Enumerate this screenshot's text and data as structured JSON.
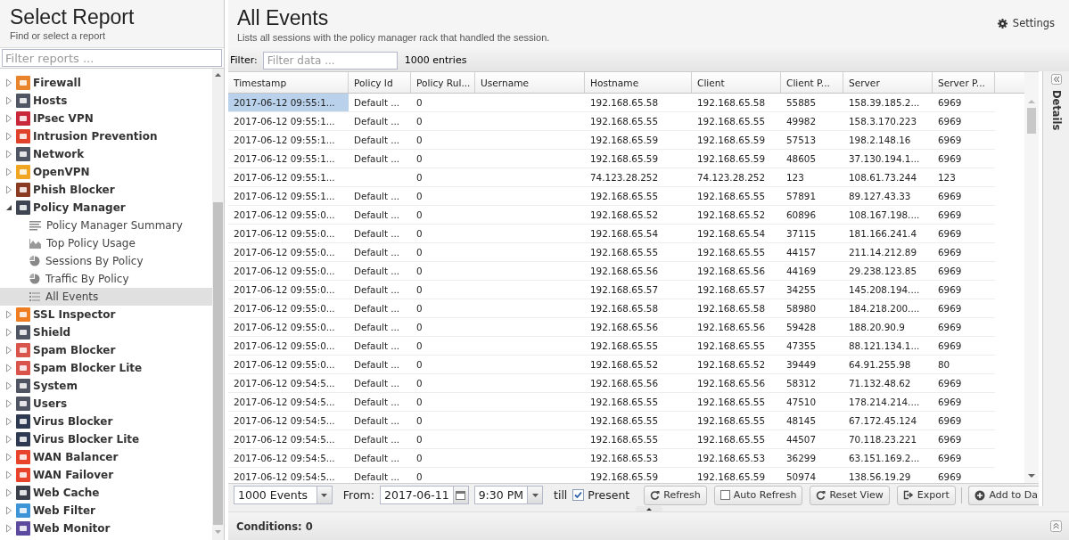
{
  "sidebar": {
    "title": "Select Report",
    "subtitle": "Find or select a report",
    "filter": {
      "placeholder": "Filter reports ..."
    },
    "items": [
      {
        "label": "Firewall",
        "color": "#e8852c",
        "expanded": false,
        "selected": false
      },
      {
        "label": "Hosts",
        "color": "#4f5563",
        "expanded": false,
        "selected": false
      },
      {
        "label": "IPsec VPN",
        "color": "#c8283a",
        "expanded": false,
        "selected": false
      },
      {
        "label": "Intrusion Prevention",
        "color": "#e0412b",
        "expanded": false,
        "selected": false
      },
      {
        "label": "Network",
        "color": "#4f5563",
        "expanded": false,
        "selected": false
      },
      {
        "label": "OpenVPN",
        "color": "#f0a623",
        "expanded": false,
        "selected": false
      },
      {
        "label": "Phish Blocker",
        "color": "#8a3b22",
        "expanded": false,
        "selected": false
      },
      {
        "label": "Policy Manager",
        "color": "#3f4452",
        "expanded": true,
        "selected": false,
        "children": [
          {
            "label": "Policy Manager Summary",
            "kind": "text",
            "selected": false
          },
          {
            "label": "Top Policy Usage",
            "kind": "area",
            "selected": false
          },
          {
            "label": "Sessions By Policy",
            "kind": "pie",
            "selected": false
          },
          {
            "label": "Traffic By Policy",
            "kind": "pie",
            "selected": false
          },
          {
            "label": "All Events",
            "kind": "list",
            "selected": true
          }
        ]
      },
      {
        "label": "SSL Inspector",
        "color": "#ef7d22",
        "expanded": false,
        "selected": false
      },
      {
        "label": "Shield",
        "color": "#4f5563",
        "expanded": false,
        "selected": false
      },
      {
        "label": "Spam Blocker",
        "color": "#d9544a",
        "expanded": false,
        "selected": false
      },
      {
        "label": "Spam Blocker Lite",
        "color": "#d9544a",
        "expanded": false,
        "selected": false
      },
      {
        "label": "System",
        "color": "#4f5563",
        "expanded": false,
        "selected": false
      },
      {
        "label": "Users",
        "color": "#4f5563",
        "expanded": false,
        "selected": false
      },
      {
        "label": "Virus Blocker",
        "color": "#2d3a52",
        "expanded": false,
        "selected": false
      },
      {
        "label": "Virus Blocker Lite",
        "color": "#2d3a52",
        "expanded": false,
        "selected": false
      },
      {
        "label": "WAN Balancer",
        "color": "#e8432b",
        "expanded": false,
        "selected": false
      },
      {
        "label": "WAN Failover",
        "color": "#e8432b",
        "expanded": false,
        "selected": false
      },
      {
        "label": "Web Cache",
        "color": "#3b3f4a",
        "expanded": false,
        "selected": false
      },
      {
        "label": "Web Filter",
        "color": "#3d95d8",
        "expanded": false,
        "selected": false
      },
      {
        "label": "Web Monitor",
        "color": "#5b4a9e",
        "expanded": false,
        "selected": false
      }
    ]
  },
  "report": {
    "title": "All Events",
    "description": "Lists all sessions with the policy manager rack that handled the session.",
    "settings": "Settings"
  },
  "filter": {
    "label": "Filter:",
    "placeholder": "Filter data ...",
    "count": "1000 entries"
  },
  "table": {
    "columns": [
      "Timestamp",
      "Policy Id",
      "Policy Rul...",
      "Username",
      "Hostname",
      "Client",
      "Client P...",
      "Server",
      "Server P..."
    ],
    "rows": [
      {
        "selected": true,
        "cells": [
          "2017-06-12 09:55:1...",
          "Default ...",
          "0",
          "",
          "192.168.65.58",
          "192.168.65.58",
          "55885",
          "158.39.185.2...",
          "6969"
        ]
      },
      {
        "selected": false,
        "cells": [
          "2017-06-12 09:55:1...",
          "Default ...",
          "0",
          "",
          "192.168.65.55",
          "192.168.65.55",
          "49982",
          "158.3.170.223",
          "6969"
        ]
      },
      {
        "selected": false,
        "cells": [
          "2017-06-12 09:55:1...",
          "Default ...",
          "0",
          "",
          "192.168.65.59",
          "192.168.65.59",
          "57513",
          "198.2.148.16",
          "6969"
        ]
      },
      {
        "selected": false,
        "cells": [
          "2017-06-12 09:55:1...",
          "Default ...",
          "0",
          "",
          "192.168.65.59",
          "192.168.65.59",
          "48605",
          "37.130.194.1...",
          "6969"
        ]
      },
      {
        "selected": false,
        "cells": [
          "2017-06-12 09:55:1...",
          "",
          "0",
          "",
          "74.123.28.252",
          "74.123.28.252",
          "123",
          "108.61.73.244",
          "123"
        ]
      },
      {
        "selected": false,
        "cells": [
          "2017-06-12 09:55:1...",
          "Default ...",
          "0",
          "",
          "192.168.65.55",
          "192.168.65.55",
          "57891",
          "89.127.43.33",
          "6969"
        ]
      },
      {
        "selected": false,
        "cells": [
          "2017-06-12 09:55:0...",
          "Default ...",
          "0",
          "",
          "192.168.65.52",
          "192.168.65.52",
          "60896",
          "108.167.198....",
          "6969"
        ]
      },
      {
        "selected": false,
        "cells": [
          "2017-06-12 09:55:0...",
          "Default ...",
          "0",
          "",
          "192.168.65.54",
          "192.168.65.54",
          "37115",
          "181.166.241.4",
          "6969"
        ]
      },
      {
        "selected": false,
        "cells": [
          "2017-06-12 09:55:0...",
          "Default ...",
          "0",
          "",
          "192.168.65.55",
          "192.168.65.55",
          "44157",
          "211.14.212.89",
          "6969"
        ]
      },
      {
        "selected": false,
        "cells": [
          "2017-06-12 09:55:0...",
          "Default ...",
          "0",
          "",
          "192.168.65.56",
          "192.168.65.56",
          "44169",
          "29.238.123.85",
          "6969"
        ]
      },
      {
        "selected": false,
        "cells": [
          "2017-06-12 09:55:0...",
          "Default ...",
          "0",
          "",
          "192.168.65.57",
          "192.168.65.57",
          "34255",
          "145.208.194....",
          "6969"
        ]
      },
      {
        "selected": false,
        "cells": [
          "2017-06-12 09:55:0...",
          "Default ...",
          "0",
          "",
          "192.168.65.58",
          "192.168.65.58",
          "58980",
          "184.218.200....",
          "6969"
        ]
      },
      {
        "selected": false,
        "cells": [
          "2017-06-12 09:55:0...",
          "Default ...",
          "0",
          "",
          "192.168.65.56",
          "192.168.65.56",
          "59428",
          "188.20.90.9",
          "6969"
        ]
      },
      {
        "selected": false,
        "cells": [
          "2017-06-12 09:55:0...",
          "Default ...",
          "0",
          "",
          "192.168.65.55",
          "192.168.65.55",
          "47355",
          "88.121.134.1...",
          "6969"
        ]
      },
      {
        "selected": false,
        "cells": [
          "2017-06-12 09:55:0...",
          "Default ...",
          "0",
          "",
          "192.168.65.52",
          "192.168.65.52",
          "39449",
          "64.91.255.98",
          "80"
        ]
      },
      {
        "selected": false,
        "cells": [
          "2017-06-12 09:54:5...",
          "Default ...",
          "0",
          "",
          "192.168.65.56",
          "192.168.65.56",
          "58312",
          "71.132.48.62",
          "6969"
        ]
      },
      {
        "selected": false,
        "cells": [
          "2017-06-12 09:54:5...",
          "Default ...",
          "0",
          "",
          "192.168.65.55",
          "192.168.65.55",
          "47510",
          "178.214.214....",
          "6969"
        ]
      },
      {
        "selected": false,
        "cells": [
          "2017-06-12 09:54:5...",
          "Default ...",
          "0",
          "",
          "192.168.65.55",
          "192.168.65.55",
          "48145",
          "67.172.45.124",
          "6969"
        ]
      },
      {
        "selected": false,
        "cells": [
          "2017-06-12 09:54:5...",
          "Default ...",
          "0",
          "",
          "192.168.65.55",
          "192.168.65.55",
          "44507",
          "70.118.23.221",
          "6969"
        ]
      },
      {
        "selected": false,
        "cells": [
          "2017-06-12 09:54:5...",
          "Default ...",
          "0",
          "",
          "192.168.65.53",
          "192.168.65.53",
          "36299",
          "63.151.169.2...",
          "6969"
        ]
      },
      {
        "selected": false,
        "cells": [
          "2017-06-12 09:54:5...",
          "Default ...",
          "0",
          "",
          "192.168.65.59",
          "192.168.65.59",
          "50974",
          "138.56.19.29",
          "6969"
        ]
      }
    ]
  },
  "details": {
    "label": "Details"
  },
  "toolbar": {
    "limit": "1000 Events",
    "from_label": "From:",
    "date": "2017-06-11",
    "time": "9:30 PM",
    "till": "till",
    "present": {
      "label": "Present",
      "checked": true
    },
    "buttons": [
      {
        "kind": "refresh",
        "label": "Refresh"
      },
      {
        "kind": "toggle",
        "label": "Auto Refresh",
        "checked": false
      },
      {
        "kind": "reset",
        "label": "Reset View"
      },
      {
        "kind": "export",
        "label": "Export"
      },
      {
        "kind": "add",
        "label": "Add to Da"
      }
    ]
  },
  "conditions": {
    "label": "Conditions: 0"
  }
}
